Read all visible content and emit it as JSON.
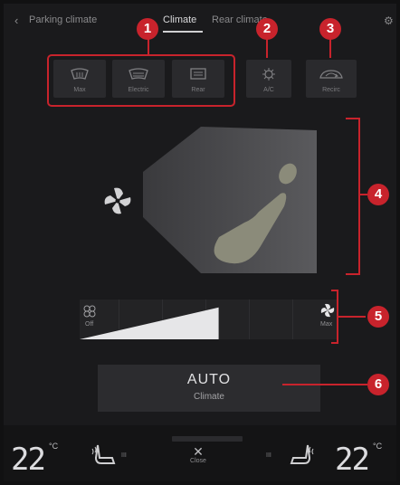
{
  "nav": {
    "tabs": [
      "Parking climate",
      "Climate",
      "Rear climate"
    ],
    "active_tab": "Climate"
  },
  "buttons": {
    "max_label": "Max",
    "electric_label": "Electric",
    "rear_label": "Rear",
    "ac_label": "A/C",
    "recirc_label": "Recirc"
  },
  "fan": {
    "left_label": "Off",
    "right_label": "Max",
    "level_fraction": 0.6
  },
  "auto": {
    "title": "AUTO",
    "subtitle": "Climate"
  },
  "bottom": {
    "temp_left": "22",
    "temp_right": "22",
    "unit": "°C",
    "close_label": "Close",
    "heat_left_levels": "III",
    "heat_right_levels": "III"
  },
  "callouts": [
    "1",
    "2",
    "3",
    "4",
    "5",
    "6"
  ],
  "colors": {
    "accent_red": "#c8232c",
    "background": "#1a1a1c",
    "button_bg": "#2a2a2d",
    "text": "#dcdcdf"
  },
  "icons": {
    "back": "chevron-left-icon",
    "max": "windscreen-defrost-max-icon",
    "electric": "windscreen-defrost-electric-icon",
    "rear": "rear-window-defrost-icon",
    "ac": "snowflake-icon",
    "recirc": "recirculation-icon",
    "fan": "fan-icon",
    "seat_heat": "seat-heating-icon",
    "close": "close-icon"
  }
}
